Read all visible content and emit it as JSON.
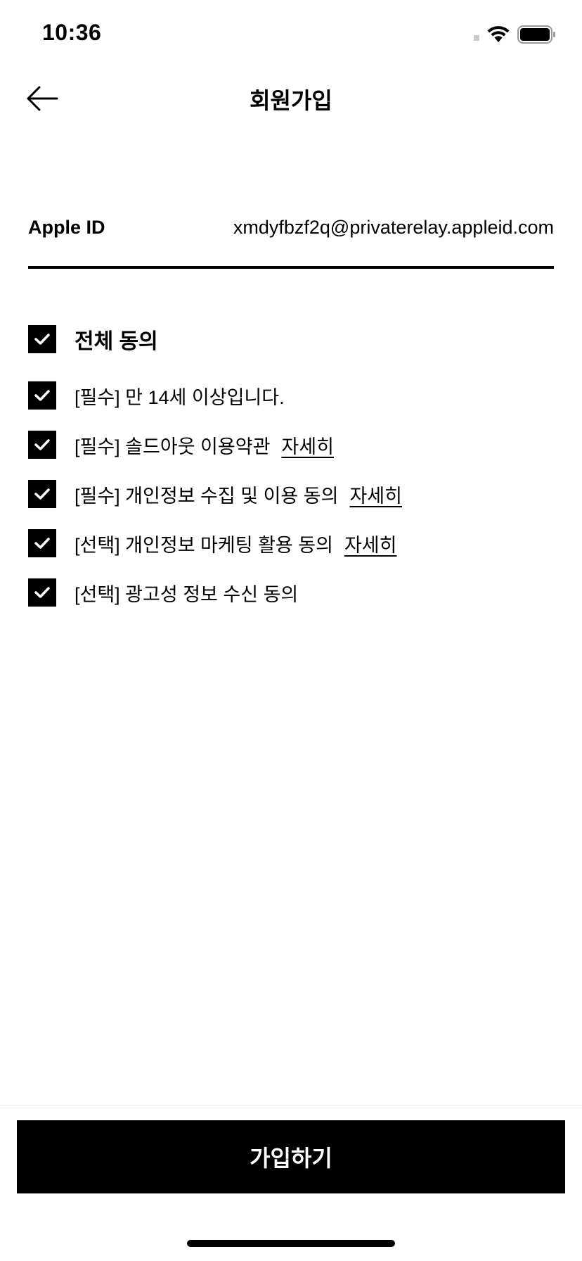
{
  "status_bar": {
    "time": "10:36",
    "icons": [
      "signal-icon",
      "wifi-icon",
      "battery-icon"
    ]
  },
  "nav": {
    "back_icon": "arrow-left-icon",
    "title": "회원가입"
  },
  "apple_id": {
    "label": "Apple ID",
    "value": "xmdyfbzf2q@privaterelay.appleid.com"
  },
  "agreements": {
    "all": {
      "label": "전체 동의",
      "checked": true
    },
    "items": [
      {
        "label": "[필수] 만 14세 이상입니다.",
        "checked": true,
        "detail": ""
      },
      {
        "label": "[필수] 솔드아웃 이용약관",
        "checked": true,
        "detail": "자세히"
      },
      {
        "label": "[필수] 개인정보 수집 및 이용 동의",
        "checked": true,
        "detail": "자세히"
      },
      {
        "label": "[선택] 개인정보 마케팅 활용 동의",
        "checked": true,
        "detail": "자세히"
      },
      {
        "label": "[선택] 광고성 정보 수신 동의",
        "checked": true,
        "detail": ""
      }
    ]
  },
  "signup_button": {
    "label": "가입하기"
  },
  "colors": {
    "primary": "#000000",
    "background": "#ffffff",
    "divider": "#ececec"
  }
}
